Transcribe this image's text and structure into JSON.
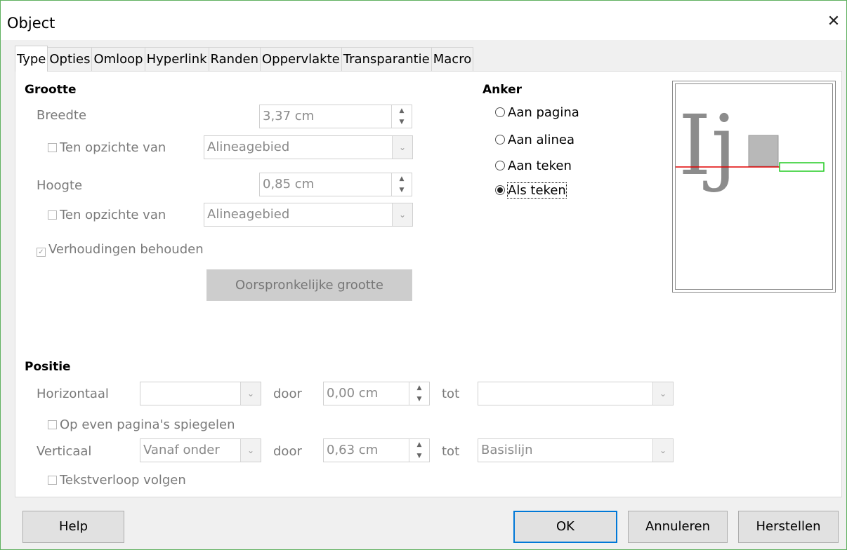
{
  "dialog": {
    "title": "Object",
    "close_icon": "close-icon"
  },
  "tabs": [
    {
      "label": "Type",
      "active": true
    },
    {
      "label": "Opties"
    },
    {
      "label": "Omloop"
    },
    {
      "label": "Hyperlink"
    },
    {
      "label": "Randen"
    },
    {
      "label": "Oppervlakte"
    },
    {
      "label": "Transparantie"
    },
    {
      "label": "Macro"
    }
  ],
  "size": {
    "header": "Grootte",
    "width_label": "Breedte",
    "width_value": "3,37 cm",
    "width_relative_label": "Ten opzichte van",
    "width_relative_value": "Alineagebied",
    "height_label": "Hoogte",
    "height_value": "0,85 cm",
    "height_relative_label": "Ten opzichte van",
    "height_relative_value": "Alineagebied",
    "keep_ratio_label": "Verhoudingen behouden",
    "keep_ratio_checked": true,
    "original_size_label": "Oorspronkelijke grootte"
  },
  "anchor": {
    "header": "Anker",
    "options": [
      "Aan pagina",
      "Aan alinea",
      "Aan teken",
      "Als teken"
    ],
    "selected": "Als teken"
  },
  "preview": {
    "glyph": "Ij",
    "colors": {
      "baseline": "#e00000",
      "box_outline": "#22cc22",
      "object": "#b8b8b8"
    }
  },
  "position": {
    "header": "Positie",
    "horizontal_label": "Horizontaal",
    "horizontal_value": "",
    "h_by_label": "door",
    "h_by_value": "0,00 cm",
    "h_to_label": "tot",
    "h_to_value": "",
    "mirror_label": "Op even pagina's spiegelen",
    "vertical_label": "Verticaal",
    "vertical_value": "Vanaf onder",
    "v_by_label": "door",
    "v_by_value": "0,63 cm",
    "v_to_label": "tot",
    "v_to_value": "Basislijn",
    "follow_flow_label": "Tekstverloop volgen"
  },
  "footer": {
    "help": "Help",
    "ok": "OK",
    "cancel": "Annuleren",
    "reset": "Herstellen"
  },
  "colors": {
    "accent": "#0078d7",
    "window_border": "#5fb05f"
  }
}
